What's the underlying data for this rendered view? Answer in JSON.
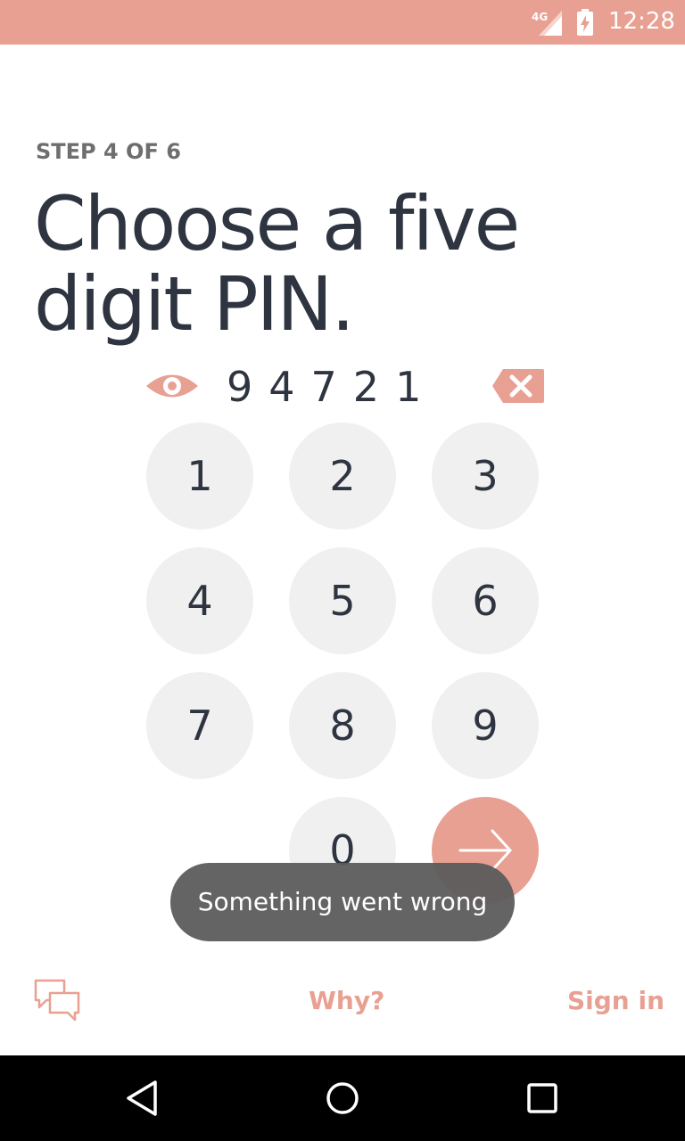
{
  "status_bar": {
    "network": "4G",
    "time": "12:28",
    "color": "#e8a092"
  },
  "step": {
    "label": "STEP 4 OF 6"
  },
  "headline": "Choose a five digit PIN.",
  "pin": {
    "value": "94721",
    "eye_icon": "eye-icon",
    "backspace_icon": "backspace-icon"
  },
  "keypad": {
    "keys": [
      "1",
      "2",
      "3",
      "4",
      "5",
      "6",
      "7",
      "8",
      "9",
      "0"
    ],
    "submit_icon": "arrow-right-icon"
  },
  "toast": {
    "message": "Something went wrong"
  },
  "footer": {
    "chat_icon": "chat-icon",
    "why_label": "Why?",
    "signin_label": "Sign in"
  },
  "nav": {
    "back_icon": "back-triangle-icon",
    "home_icon": "home-circle-icon",
    "recents_icon": "recents-square-icon"
  },
  "colors": {
    "accent": "#e8a092",
    "text": "#2e3440",
    "key_bg": "#f0f0f0",
    "toast_bg": "#5a5a5a"
  }
}
